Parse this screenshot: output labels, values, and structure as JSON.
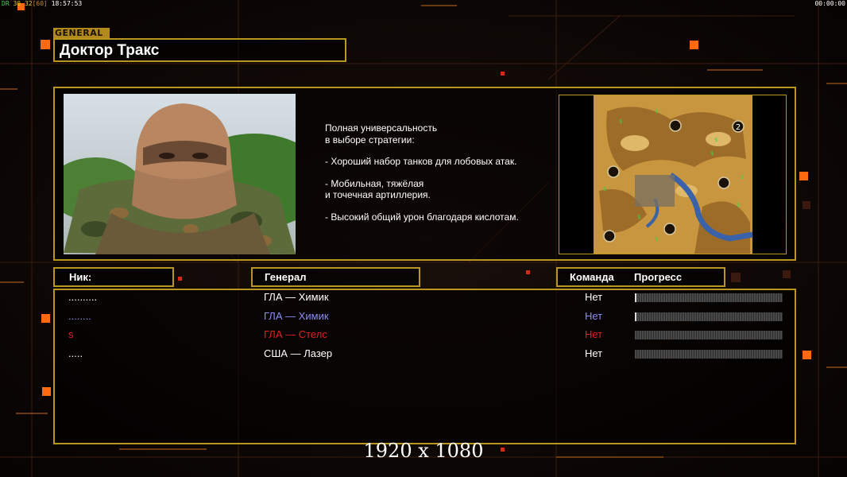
{
  "hud": {
    "fps_label": "DR",
    "fps_value": "30",
    "frame": "32",
    "frame_max": "[60]",
    "clock": "18:57:53",
    "timer": "00:00:00"
  },
  "general": {
    "tag": "GENERAL",
    "name": "Доктор Тракс"
  },
  "description": {
    "lines": [
      "Полная универсальность",
      "в выборе стратегии:",
      "",
      "- Хороший набор танков для лобовых атак.",
      "",
      "- Мобильная, тяжёлая",
      "и точечная артиллерия.",
      "",
      "- Высокий общий урон благодаря кислотам."
    ]
  },
  "map": {
    "marker_label": "2"
  },
  "columns": {
    "nick": "Ник:",
    "general": "Генерал",
    "team": "Команда",
    "progress": "Прогресс"
  },
  "players": [
    {
      "nick": "..........",
      "general": "ГЛА — Химик",
      "team": "Нет",
      "color": "#ffffff",
      "progress": 0.01
    },
    {
      "nick": "........",
      "general": "ГЛА — Химик",
      "team": "Нет",
      "color": "#8c8cf5",
      "progress": 0.01
    },
    {
      "nick": "s",
      "general": "ГЛА — Стелс",
      "team": "Нет",
      "color": "#e32020",
      "progress": 0
    },
    {
      "nick": ".....",
      "general": "США — Лазер",
      "team": "Нет",
      "color": "#ffffff",
      "progress": 0
    }
  ],
  "resolution": "1920 x 1080",
  "colors": {
    "accent": "#b8961f",
    "orange": "#ff7a1a"
  }
}
